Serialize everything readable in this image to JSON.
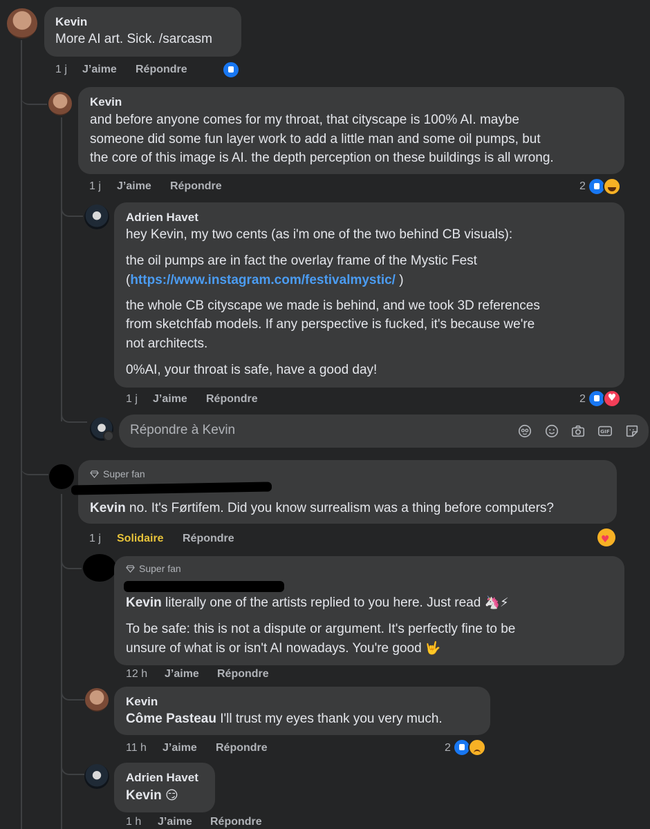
{
  "comments": {
    "c1": {
      "author": "Kevin",
      "text": "More AI art. Sick. /sarcasm",
      "time": "1 j",
      "like": "J’aime",
      "reply": "Répondre"
    },
    "c2": {
      "author": "Kevin",
      "lines": [
        "and before anyone comes for my throat, that cityscape is 100% AI. maybe",
        "someone did some fun layer work to add a little man and some oil pumps, but",
        "the core of this image is AI. the depth perception on these buildings is all wrong."
      ],
      "time": "1 j",
      "like": "J’aime",
      "reply": "Répondre",
      "reaction_count": "2"
    },
    "c3": {
      "author": "Adrien Havet",
      "p1": "hey Kevin, my two cents (as i'm one of the two behind CB visuals):",
      "p2_line1": "the oil pumps are in fact the overlay frame of the Mystic Fest",
      "p2_open": "(",
      "p2_link": "https://www.instagram.com/festivalmystic/",
      "p2_close": " )",
      "p3_lines": [
        "the whole CB cityscape we made is behind, and we took 3D references",
        "from sketchfab models. If any perspective is fucked, it's because we're",
        "not architects."
      ],
      "p4": "0%AI, your throat is safe, have a good day!",
      "time": "1 j",
      "like": "J’aime",
      "reply": "Répondre",
      "reaction_count": "2"
    },
    "reply_box": {
      "placeholder": "Répondre à Kevin",
      "tools": [
        "avatar-sticker-icon",
        "emoji-icon",
        "camera-icon",
        "gif-icon",
        "sticker-icon"
      ],
      "gif_label": "GIF"
    },
    "c4": {
      "badge": "Super fan",
      "mention": "Kevin",
      "text": " no. It's Førtifem. Did you know surrealism was a thing before computers?",
      "time": "1 j",
      "like": "Solidaire",
      "reply": "Répondre"
    },
    "c5": {
      "badge": "Super fan",
      "mention": "Kevin",
      "text": " literally one of the artists replied to you here. Just read ",
      "emoji1": "🦄⚡",
      "line2": "To be safe: this is not a dispute or argument. It's perfectly fine to be",
      "line3": "unsure of what is or isn't AI nowadays. You're good ",
      "emoji2": "🤟",
      "time": "12 h",
      "like": "J’aime",
      "reply": "Répondre"
    },
    "c6": {
      "author": "Kevin",
      "mention": "Côme Pasteau",
      "text": " I'll trust my eyes thank you very much.",
      "time": "11 h",
      "like": "J’aime",
      "reply": "Répondre",
      "reaction_count": "2"
    },
    "c7": {
      "author": "Adrien Havet",
      "mention": "Kevin",
      "emoji": "😏",
      "time": "1 h",
      "like": "J’aime",
      "reply": "Répondre"
    }
  },
  "colors": {
    "background": "#242526",
    "bubble": "#3a3b3c",
    "link": "#4b9cf2",
    "like_blue": "#1877f2",
    "heart_red": "#f33e58",
    "solidaire_gold": "#e6c23a"
  }
}
